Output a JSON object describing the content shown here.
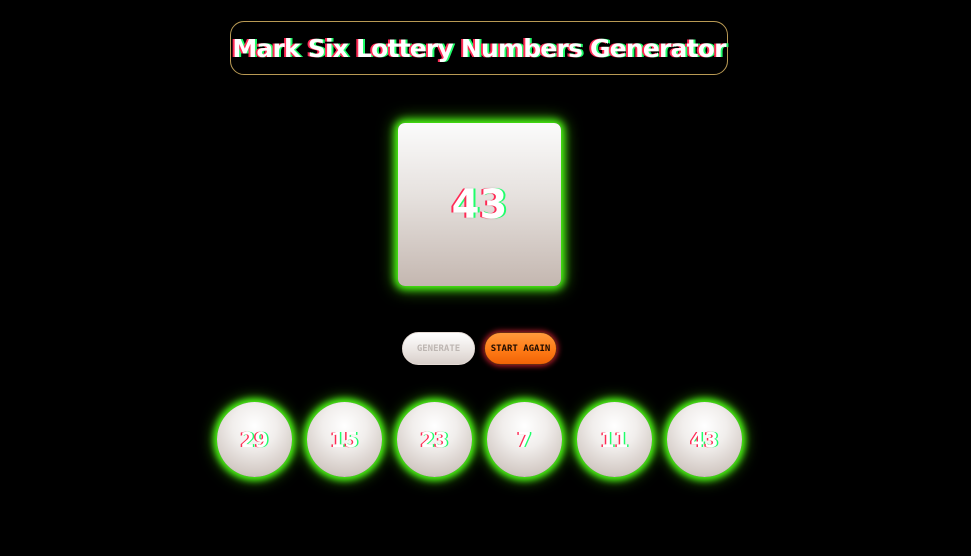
{
  "header": {
    "title": "Mark Six Lottery Numbers Generator"
  },
  "display": {
    "current_number": "43"
  },
  "controls": {
    "generate_label": "GENERATE",
    "start_again_label": "START AGAIN"
  },
  "balls": [
    "29",
    "15",
    "23",
    "7",
    "11",
    "43"
  ],
  "colors": {
    "background": "#000000",
    "glow": "#4dff16",
    "title_border": "#b99a54",
    "accent_button": "#ff7b16",
    "text_shadow_red": "#ff2a55",
    "text_shadow_green": "#1fff6a"
  }
}
